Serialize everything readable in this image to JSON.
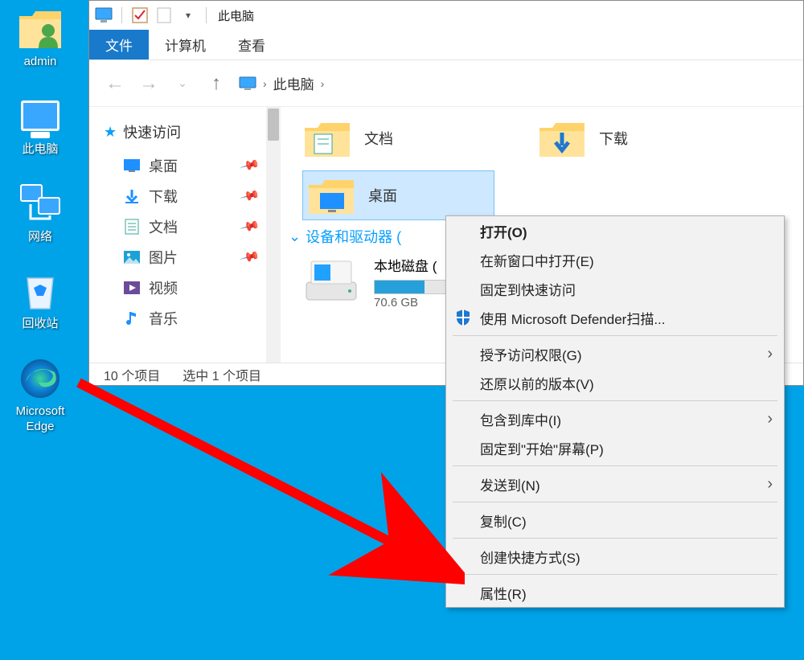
{
  "desktop": {
    "icons": [
      {
        "name": "admin",
        "label": "admin",
        "type": "user"
      },
      {
        "name": "this-pc",
        "label": "此电脑",
        "type": "pc"
      },
      {
        "name": "network",
        "label": "网络",
        "type": "network"
      },
      {
        "name": "recycle-bin",
        "label": "回收站",
        "type": "recycle"
      },
      {
        "name": "edge",
        "label": "Microsoft Edge",
        "type": "edge"
      }
    ]
  },
  "explorer": {
    "title": "此电脑",
    "tabs": {
      "file": "文件",
      "computer": "计算机",
      "view": "查看"
    },
    "breadcrumb": [
      "此电脑"
    ],
    "sidebar": {
      "quick_access": "快速访问",
      "items": [
        {
          "label": "桌面",
          "icon": "desktop"
        },
        {
          "label": "下载",
          "icon": "downloads"
        },
        {
          "label": "文档",
          "icon": "documents"
        },
        {
          "label": "图片",
          "icon": "pictures"
        },
        {
          "label": "视频",
          "icon": "videos"
        },
        {
          "label": "音乐",
          "icon": "music"
        }
      ]
    },
    "content": {
      "row1": [
        {
          "label": "文档",
          "icon": "documents-folder"
        },
        {
          "label": "下载",
          "icon": "downloads-folder"
        }
      ],
      "selected": {
        "label": "桌面"
      },
      "devices_header": "设备和驱动器 (",
      "drive": {
        "label": "本地磁盘 (",
        "size": "70.6 GB"
      }
    },
    "status": {
      "items": "10 个项目",
      "selected": "选中 1 个项目"
    }
  },
  "context_menu": {
    "items": [
      {
        "label": "打开(O)",
        "bold": true
      },
      {
        "label": "在新窗口中打开(E)"
      },
      {
        "label": "固定到快速访问"
      },
      {
        "label": "使用 Microsoft Defender扫描...",
        "icon": "defender"
      },
      {
        "sep": true
      },
      {
        "label": "授予访问权限(G)",
        "submenu": true
      },
      {
        "label": "还原以前的版本(V)"
      },
      {
        "sep": true
      },
      {
        "label": "包含到库中(I)",
        "submenu": true
      },
      {
        "label": "固定到\"开始\"屏幕(P)"
      },
      {
        "sep": true
      },
      {
        "label": "发送到(N)",
        "submenu": true
      },
      {
        "sep": true
      },
      {
        "label": "复制(C)"
      },
      {
        "sep": true
      },
      {
        "label": "创建快捷方式(S)"
      },
      {
        "sep": true
      },
      {
        "label": "属性(R)"
      }
    ]
  }
}
